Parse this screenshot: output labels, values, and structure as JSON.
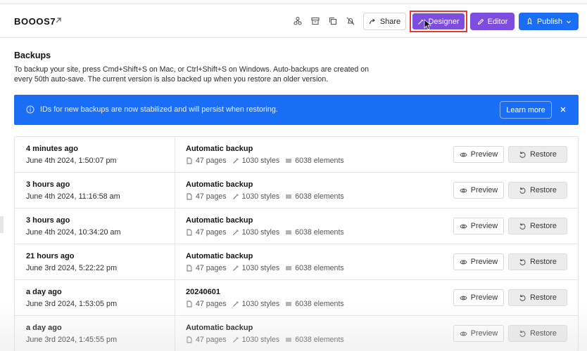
{
  "header": {
    "site_name": "BOOOS7",
    "share_label": "Share",
    "designer_label": "Designer",
    "editor_label": "Editor",
    "publish_label": "Publish"
  },
  "section": {
    "title": "Backups",
    "description": "To backup your site, press Cmd+Shift+S on Mac, or Ctrl+Shift+S on Windows. Auto-backups are created on every 50th auto-save. The current version is also backed up when you restore an older version."
  },
  "banner": {
    "text": "IDs for new backups are now stabilized and will persist when restoring.",
    "learn_more_label": "Learn more"
  },
  "backups": [
    {
      "when": "4 minutes ago",
      "date": "June 4th 2024, 1:50:07 pm",
      "name": "Automatic backup",
      "pages": "47 pages",
      "styles": "1030 styles",
      "elements": "6038 elements"
    },
    {
      "when": "3 hours ago",
      "date": "June 4th 2024, 11:16:58 am",
      "name": "Automatic backup",
      "pages": "47 pages",
      "styles": "1030 styles",
      "elements": "6038 elements"
    },
    {
      "when": "3 hours ago",
      "date": "June 4th 2024, 10:34:20 am",
      "name": "Automatic backup",
      "pages": "47 pages",
      "styles": "1030 styles",
      "elements": "6038 elements"
    },
    {
      "when": "21 hours ago",
      "date": "June 3rd 2024, 5:22:22 pm",
      "name": "Automatic backup",
      "pages": "47 pages",
      "styles": "1030 styles",
      "elements": "6038 elements"
    },
    {
      "when": "a day ago",
      "date": "June 3rd 2024, 1:53:05 pm",
      "name": "20240601",
      "pages": "47 pages",
      "styles": "1030 styles",
      "elements": "6038 elements"
    },
    {
      "when": "a day ago",
      "date": "June 3rd 2024, 1:45:55 pm",
      "name": "Automatic backup",
      "pages": "47 pages",
      "styles": "1030 styles",
      "elements": "6038 elements"
    }
  ],
  "row_actions": {
    "preview_label": "Preview",
    "restore_label": "Restore"
  },
  "colors": {
    "accent_purple": "#7c4dde",
    "accent_blue": "#1a6ef5",
    "highlight_red": "#e53935"
  }
}
